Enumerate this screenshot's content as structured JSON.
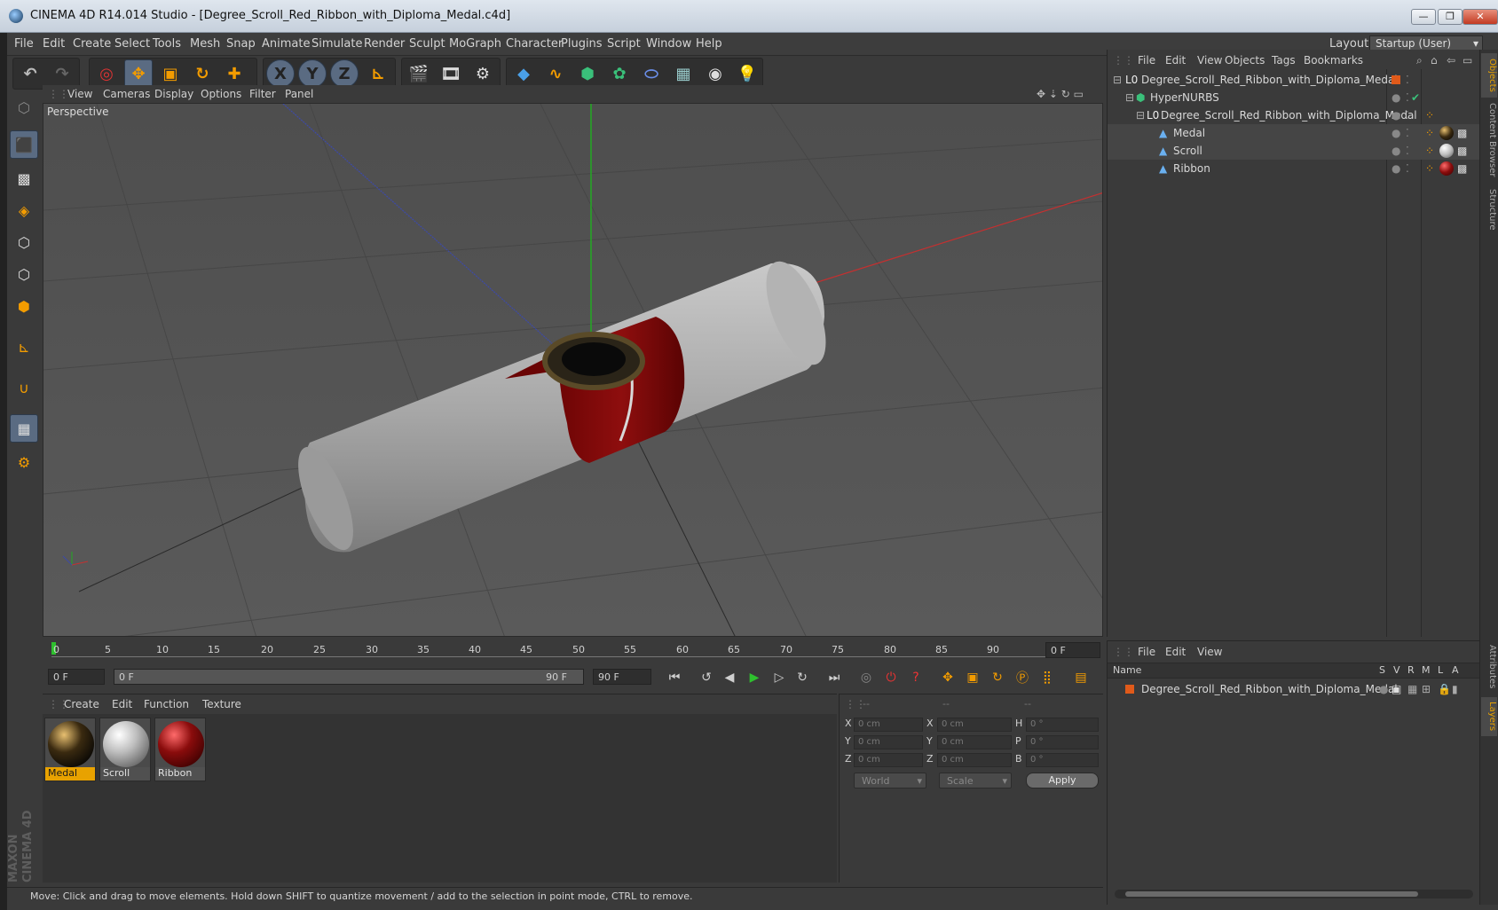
{
  "window": {
    "title": "CINEMA 4D R14.014 Studio - [Degree_Scroll_Red_Ribbon_with_Diploma_Medal.c4d]"
  },
  "menubar": {
    "items": [
      "File",
      "Edit",
      "Create",
      "Select",
      "Tools",
      "Mesh",
      "Snap",
      "Animate",
      "Simulate",
      "Render",
      "Sculpt",
      "MoGraph",
      "Character",
      "Plugins",
      "Script",
      "Window",
      "Help"
    ],
    "layout_label": "Layout:",
    "layout_value": "Startup (User)"
  },
  "toolbar": {
    "axis_x": "X",
    "axis_y": "Y",
    "axis_z": "Z"
  },
  "viewport": {
    "menu": [
      "View",
      "Cameras",
      "Display",
      "Options",
      "Filter",
      "Panel"
    ],
    "label": "Perspective"
  },
  "timeline": {
    "ticks": [
      "0",
      "5",
      "10",
      "15",
      "20",
      "25",
      "30",
      "35",
      "40",
      "45",
      "50",
      "55",
      "60",
      "65",
      "70",
      "75",
      "80",
      "85",
      "90"
    ],
    "current_frame": "0 F",
    "start_frame": "0 F",
    "range_start": "0 F",
    "range_end": "90 F",
    "end_frame": "90 F"
  },
  "materials": {
    "menu": [
      "Create",
      "Edit",
      "Function",
      "Texture"
    ],
    "items": [
      {
        "name": "Medal",
        "color": "#3a2a10"
      },
      {
        "name": "Scroll",
        "color": "#bdbdbd"
      },
      {
        "name": "Ribbon",
        "color": "#8a0c0c"
      }
    ]
  },
  "coordinates": {
    "header": [
      "--",
      "--",
      "--"
    ],
    "rows": [
      {
        "a": "X",
        "av": "0 cm",
        "b": "X",
        "bv": "0 cm",
        "c": "H",
        "cv": "0 °"
      },
      {
        "a": "Y",
        "av": "0 cm",
        "b": "Y",
        "bv": "0 cm",
        "c": "P",
        "cv": "0 °"
      },
      {
        "a": "Z",
        "av": "0 cm",
        "b": "Z",
        "bv": "0 cm",
        "c": "B",
        "cv": "0 °"
      }
    ],
    "space": "World",
    "mode": "Scale",
    "apply": "Apply"
  },
  "objects": {
    "menu": [
      "File",
      "Edit",
      "View",
      "Objects",
      "Tags",
      "Bookmarks"
    ],
    "tree": [
      {
        "name": "Degree_Scroll_Red_Ribbon_with_Diploma_Medal"
      },
      {
        "name": "HyperNURBS"
      },
      {
        "name": "Degree_Scroll_Red_Ribbon_with_Diploma_Medal"
      },
      {
        "name": "Medal"
      },
      {
        "name": "Scroll"
      },
      {
        "name": "Ribbon"
      }
    ]
  },
  "layers": {
    "menu": [
      "File",
      "Edit",
      "View"
    ],
    "header_name": "Name",
    "columns": [
      "S",
      "V",
      "R",
      "M",
      "L",
      "A"
    ],
    "rows": [
      {
        "name": "Degree_Scroll_Red_Ribbon_with_Diploma_Medal"
      }
    ]
  },
  "sidetabs": [
    "Objects",
    "Content Browser",
    "Structure",
    "Attributes",
    "Layers"
  ],
  "brand": {
    "line1": "MAXON",
    "line2": "CINEMA 4D"
  },
  "status": "Move: Click and drag to move elements. Hold down SHIFT to quantize movement / add to the selection in point mode, CTRL to remove."
}
